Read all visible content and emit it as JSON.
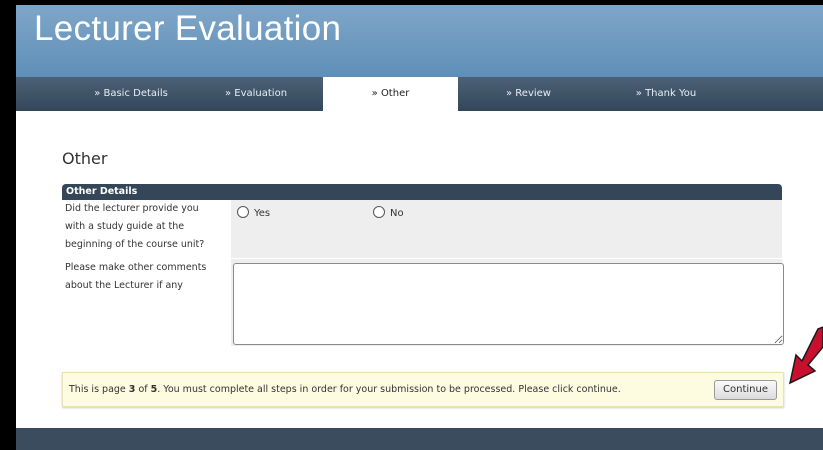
{
  "app": {
    "title": "Lecturer Evaluation"
  },
  "tabs": [
    {
      "label": "» Basic Details",
      "active": false
    },
    {
      "label": "» Evaluation",
      "active": false
    },
    {
      "label": "» Other",
      "active": true
    },
    {
      "label": "» Review",
      "active": false
    },
    {
      "label": "» Thank You",
      "active": false
    }
  ],
  "section": {
    "title": "Other"
  },
  "panel": {
    "header": "Other Details",
    "q1": {
      "label_lines": [
        "Did the lecturer provide you",
        "with a study guide at the",
        "beginning of the course unit?"
      ],
      "options": [
        "Yes",
        "No"
      ],
      "selected": null
    },
    "q2": {
      "label_lines": [
        "Please make other comments",
        "about the Lecturer if any"
      ],
      "value": ""
    }
  },
  "notice": {
    "pre": "This is page ",
    "current_page": "3",
    "mid": " of ",
    "total_pages": "5",
    "post": ". You must complete all steps in order for your submission to be processed. Please click continue.",
    "button_label": "Continue"
  },
  "colors": {
    "header": "#6b96bf",
    "tabbar": "#3e5368",
    "panel_header": "#344657",
    "notice_bg": "#fdfbe0",
    "arrow": "#c8102e"
  }
}
